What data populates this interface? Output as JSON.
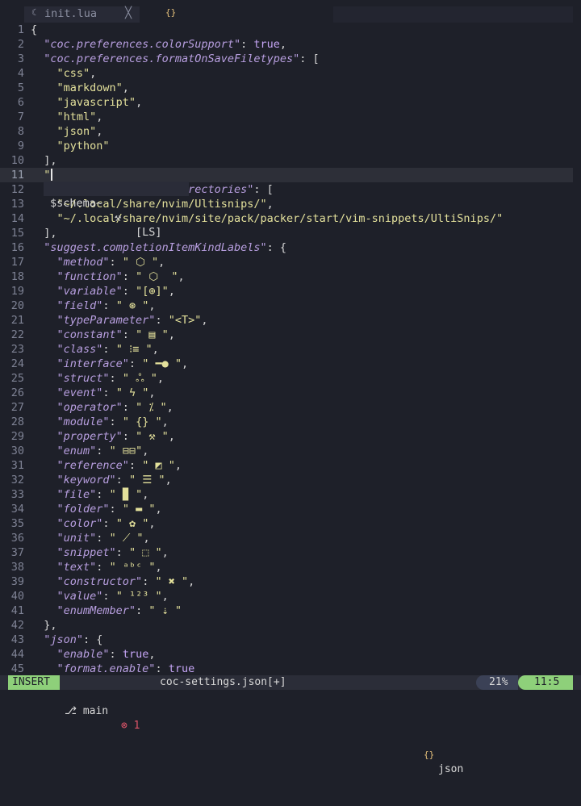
{
  "tabs": {
    "active": {
      "icon": "lua-file-icon",
      "name": "init.lua",
      "close_glyph": "╳"
    },
    "second": {
      "icon": "json-braces-icon",
      "glyph": "{}"
    }
  },
  "popup": {
    "item": "$schema~",
    "source": "[LS]",
    "icon": "wrench-icon"
  },
  "lines": [
    {
      "n": "1",
      "t": [
        [
          "p",
          "{"
        ]
      ]
    },
    {
      "n": "2",
      "t": [
        [
          "p",
          "  "
        ],
        [
          "k",
          "\"coc.preferences.colorSupport\""
        ],
        [
          "p",
          ": "
        ],
        [
          "b",
          "true"
        ],
        [
          "p",
          ","
        ]
      ]
    },
    {
      "n": "3",
      "t": [
        [
          "p",
          "  "
        ],
        [
          "k",
          "\"coc.preferences.formatOnSaveFiletypes\""
        ],
        [
          "p",
          ": ["
        ]
      ]
    },
    {
      "n": "4",
      "t": [
        [
          "p",
          "    "
        ],
        [
          "s",
          "\"css\""
        ],
        [
          "p",
          ","
        ]
      ]
    },
    {
      "n": "5",
      "t": [
        [
          "p",
          "    "
        ],
        [
          "s",
          "\"markdown\""
        ],
        [
          "p",
          ","
        ]
      ]
    },
    {
      "n": "6",
      "t": [
        [
          "p",
          "    "
        ],
        [
          "s",
          "\"javascript\""
        ],
        [
          "p",
          ","
        ]
      ]
    },
    {
      "n": "7",
      "t": [
        [
          "p",
          "    "
        ],
        [
          "s",
          "\"html\""
        ],
        [
          "p",
          ","
        ]
      ]
    },
    {
      "n": "8",
      "t": [
        [
          "p",
          "    "
        ],
        [
          "s",
          "\"json\""
        ],
        [
          "p",
          ","
        ]
      ]
    },
    {
      "n": "9",
      "t": [
        [
          "p",
          "    "
        ],
        [
          "s",
          "\"python\""
        ]
      ]
    },
    {
      "n": "10",
      "t": [
        [
          "p",
          "  ],"
        ]
      ]
    },
    {
      "n": "11",
      "cur": true,
      "t": [
        [
          "p",
          "  "
        ],
        [
          "s",
          "\""
        ]
      ]
    },
    {
      "n": "12",
      "t": [
        [
          "p",
          "                    "
        ],
        [
          "k",
          "s.directories\""
        ],
        [
          "p",
          ": ["
        ]
      ]
    },
    {
      "n": "13",
      "t": [
        [
          "p",
          "    "
        ],
        [
          "s",
          "\"~/.local/share/nvim/Ultisnips/\""
        ],
        [
          "p",
          ","
        ]
      ]
    },
    {
      "n": "14",
      "t": [
        [
          "p",
          "    "
        ],
        [
          "s",
          "\"~/.local/share/nvim/site/pack/packer/start/vim-snippets/UltiSnips/\""
        ]
      ]
    },
    {
      "n": "15",
      "t": [
        [
          "p",
          "  ],"
        ]
      ]
    },
    {
      "n": "16",
      "t": [
        [
          "p",
          "  "
        ],
        [
          "k",
          "\"suggest.completionItemKindLabels\""
        ],
        [
          "p",
          ": {"
        ]
      ]
    },
    {
      "n": "17",
      "t": [
        [
          "p",
          "    "
        ],
        [
          "k",
          "\"method\""
        ],
        [
          "p",
          ": "
        ],
        [
          "s",
          "\" ⬡ \""
        ],
        [
          "p",
          ","
        ]
      ]
    },
    {
      "n": "18",
      "t": [
        [
          "p",
          "    "
        ],
        [
          "k",
          "\"function\""
        ],
        [
          "p",
          ": "
        ],
        [
          "s",
          "\" ⬡  \""
        ],
        [
          "p",
          ","
        ]
      ]
    },
    {
      "n": "19",
      "t": [
        [
          "p",
          "    "
        ],
        [
          "k",
          "\"variable\""
        ],
        [
          "p",
          ": "
        ],
        [
          "s",
          "\"[⊕]\""
        ],
        [
          "p",
          ","
        ]
      ]
    },
    {
      "n": "20",
      "t": [
        [
          "p",
          "    "
        ],
        [
          "k",
          "\"field\""
        ],
        [
          "p",
          ": "
        ],
        [
          "s",
          "\" ⊛ \""
        ],
        [
          "p",
          ","
        ]
      ]
    },
    {
      "n": "21",
      "t": [
        [
          "p",
          "    "
        ],
        [
          "k",
          "\"typeParameter\""
        ],
        [
          "p",
          ": "
        ],
        [
          "s",
          "\"<T>\""
        ],
        [
          "p",
          ","
        ]
      ]
    },
    {
      "n": "22",
      "t": [
        [
          "p",
          "    "
        ],
        [
          "k",
          "\"constant\""
        ],
        [
          "p",
          ": "
        ],
        [
          "s",
          "\" ▤ \""
        ],
        [
          "p",
          ","
        ]
      ]
    },
    {
      "n": "23",
      "t": [
        [
          "p",
          "    "
        ],
        [
          "k",
          "\"class\""
        ],
        [
          "p",
          ": "
        ],
        [
          "s",
          "\" ⁝≡ \""
        ],
        [
          "p",
          ","
        ]
      ]
    },
    {
      "n": "24",
      "t": [
        [
          "p",
          "    "
        ],
        [
          "k",
          "\"interface\""
        ],
        [
          "p",
          ": "
        ],
        [
          "s",
          "\" ━● \""
        ],
        [
          "p",
          ","
        ]
      ]
    },
    {
      "n": "25",
      "t": [
        [
          "p",
          "    "
        ],
        [
          "k",
          "\"struct\""
        ],
        [
          "p",
          ": "
        ],
        [
          "s",
          "\" ஃ \""
        ],
        [
          "p",
          ","
        ]
      ]
    },
    {
      "n": "26",
      "t": [
        [
          "p",
          "    "
        ],
        [
          "k",
          "\"event\""
        ],
        [
          "p",
          ": "
        ],
        [
          "s",
          "\" ϟ \""
        ],
        [
          "p",
          ","
        ]
      ]
    },
    {
      "n": "27",
      "t": [
        [
          "p",
          "    "
        ],
        [
          "k",
          "\"operator\""
        ],
        [
          "p",
          ": "
        ],
        [
          "s",
          "\" ⁒ \""
        ],
        [
          "p",
          ","
        ]
      ]
    },
    {
      "n": "28",
      "t": [
        [
          "p",
          "    "
        ],
        [
          "k",
          "\"module\""
        ],
        [
          "p",
          ": "
        ],
        [
          "s",
          "\" {} \""
        ],
        [
          "p",
          ","
        ]
      ]
    },
    {
      "n": "29",
      "t": [
        [
          "p",
          "    "
        ],
        [
          "k",
          "\"property\""
        ],
        [
          "p",
          ": "
        ],
        [
          "s",
          "\" ⚒ \""
        ],
        [
          "p",
          ","
        ]
      ]
    },
    {
      "n": "30",
      "t": [
        [
          "p",
          "    "
        ],
        [
          "k",
          "\"enum\""
        ],
        [
          "p",
          ": "
        ],
        [
          "s",
          "\" ⊟⊟\""
        ],
        [
          "p",
          ","
        ]
      ]
    },
    {
      "n": "31",
      "t": [
        [
          "p",
          "    "
        ],
        [
          "k",
          "\"reference\""
        ],
        [
          "p",
          ": "
        ],
        [
          "s",
          "\" ◩ \""
        ],
        [
          "p",
          ","
        ]
      ]
    },
    {
      "n": "32",
      "t": [
        [
          "p",
          "    "
        ],
        [
          "k",
          "\"keyword\""
        ],
        [
          "p",
          ": "
        ],
        [
          "s",
          "\" ☰ \""
        ],
        [
          "p",
          ","
        ]
      ]
    },
    {
      "n": "33",
      "t": [
        [
          "p",
          "    "
        ],
        [
          "k",
          "\"file\""
        ],
        [
          "p",
          ": "
        ],
        [
          "s",
          "\" ▉ \""
        ],
        [
          "p",
          ","
        ]
      ]
    },
    {
      "n": "34",
      "t": [
        [
          "p",
          "    "
        ],
        [
          "k",
          "\"folder\""
        ],
        [
          "p",
          ": "
        ],
        [
          "s",
          "\" ▬ \""
        ],
        [
          "p",
          ","
        ]
      ]
    },
    {
      "n": "35",
      "t": [
        [
          "p",
          "    "
        ],
        [
          "k",
          "\"color\""
        ],
        [
          "p",
          ": "
        ],
        [
          "s",
          "\" ✿ \""
        ],
        [
          "p",
          ","
        ]
      ]
    },
    {
      "n": "36",
      "t": [
        [
          "p",
          "    "
        ],
        [
          "k",
          "\"unit\""
        ],
        [
          "p",
          ": "
        ],
        [
          "s",
          "\" ⟋ \""
        ],
        [
          "p",
          ","
        ]
      ]
    },
    {
      "n": "37",
      "t": [
        [
          "p",
          "    "
        ],
        [
          "k",
          "\"snippet\""
        ],
        [
          "p",
          ": "
        ],
        [
          "s",
          "\" ⬚ \""
        ],
        [
          "p",
          ","
        ]
      ]
    },
    {
      "n": "38",
      "t": [
        [
          "p",
          "    "
        ],
        [
          "k",
          "\"text\""
        ],
        [
          "p",
          ": "
        ],
        [
          "s",
          "\" ᵃᵇᶜ \""
        ],
        [
          "p",
          ","
        ]
      ]
    },
    {
      "n": "39",
      "t": [
        [
          "p",
          "    "
        ],
        [
          "k",
          "\"constructor\""
        ],
        [
          "p",
          ": "
        ],
        [
          "s",
          "\" ✖ \""
        ],
        [
          "p",
          ","
        ]
      ]
    },
    {
      "n": "40",
      "t": [
        [
          "p",
          "    "
        ],
        [
          "k",
          "\"value\""
        ],
        [
          "p",
          ": "
        ],
        [
          "s",
          "\" ¹²³ \""
        ],
        [
          "p",
          ","
        ]
      ]
    },
    {
      "n": "41",
      "t": [
        [
          "p",
          "    "
        ],
        [
          "k",
          "\"enumMember\""
        ],
        [
          "p",
          ": "
        ],
        [
          "s",
          "\" ⇣ \""
        ]
      ]
    },
    {
      "n": "42",
      "t": [
        [
          "p",
          "  },"
        ]
      ]
    },
    {
      "n": "43",
      "t": [
        [
          "p",
          "  "
        ],
        [
          "k",
          "\"json\""
        ],
        [
          "p",
          ": {"
        ]
      ]
    },
    {
      "n": "44",
      "t": [
        [
          "p",
          "    "
        ],
        [
          "k",
          "\"enable\""
        ],
        [
          "p",
          ": "
        ],
        [
          "b",
          "true"
        ],
        [
          "p",
          ","
        ]
      ]
    },
    {
      "n": "45",
      "t": [
        [
          "p",
          "    "
        ],
        [
          "k",
          "\"format.enable\""
        ],
        [
          "p",
          ": "
        ],
        [
          "b",
          "true"
        ]
      ]
    }
  ],
  "status": {
    "mode": "INSERT",
    "branch_icon": "git-branch-icon",
    "branch": "main",
    "error_icon": "error-icon",
    "errors": "1",
    "file": "coc-settings.json[+]",
    "filetype_icon": "json-braces-icon",
    "filetype_glyph": "{}",
    "filetype": "json",
    "percent": "21%",
    "position": "11:5"
  }
}
